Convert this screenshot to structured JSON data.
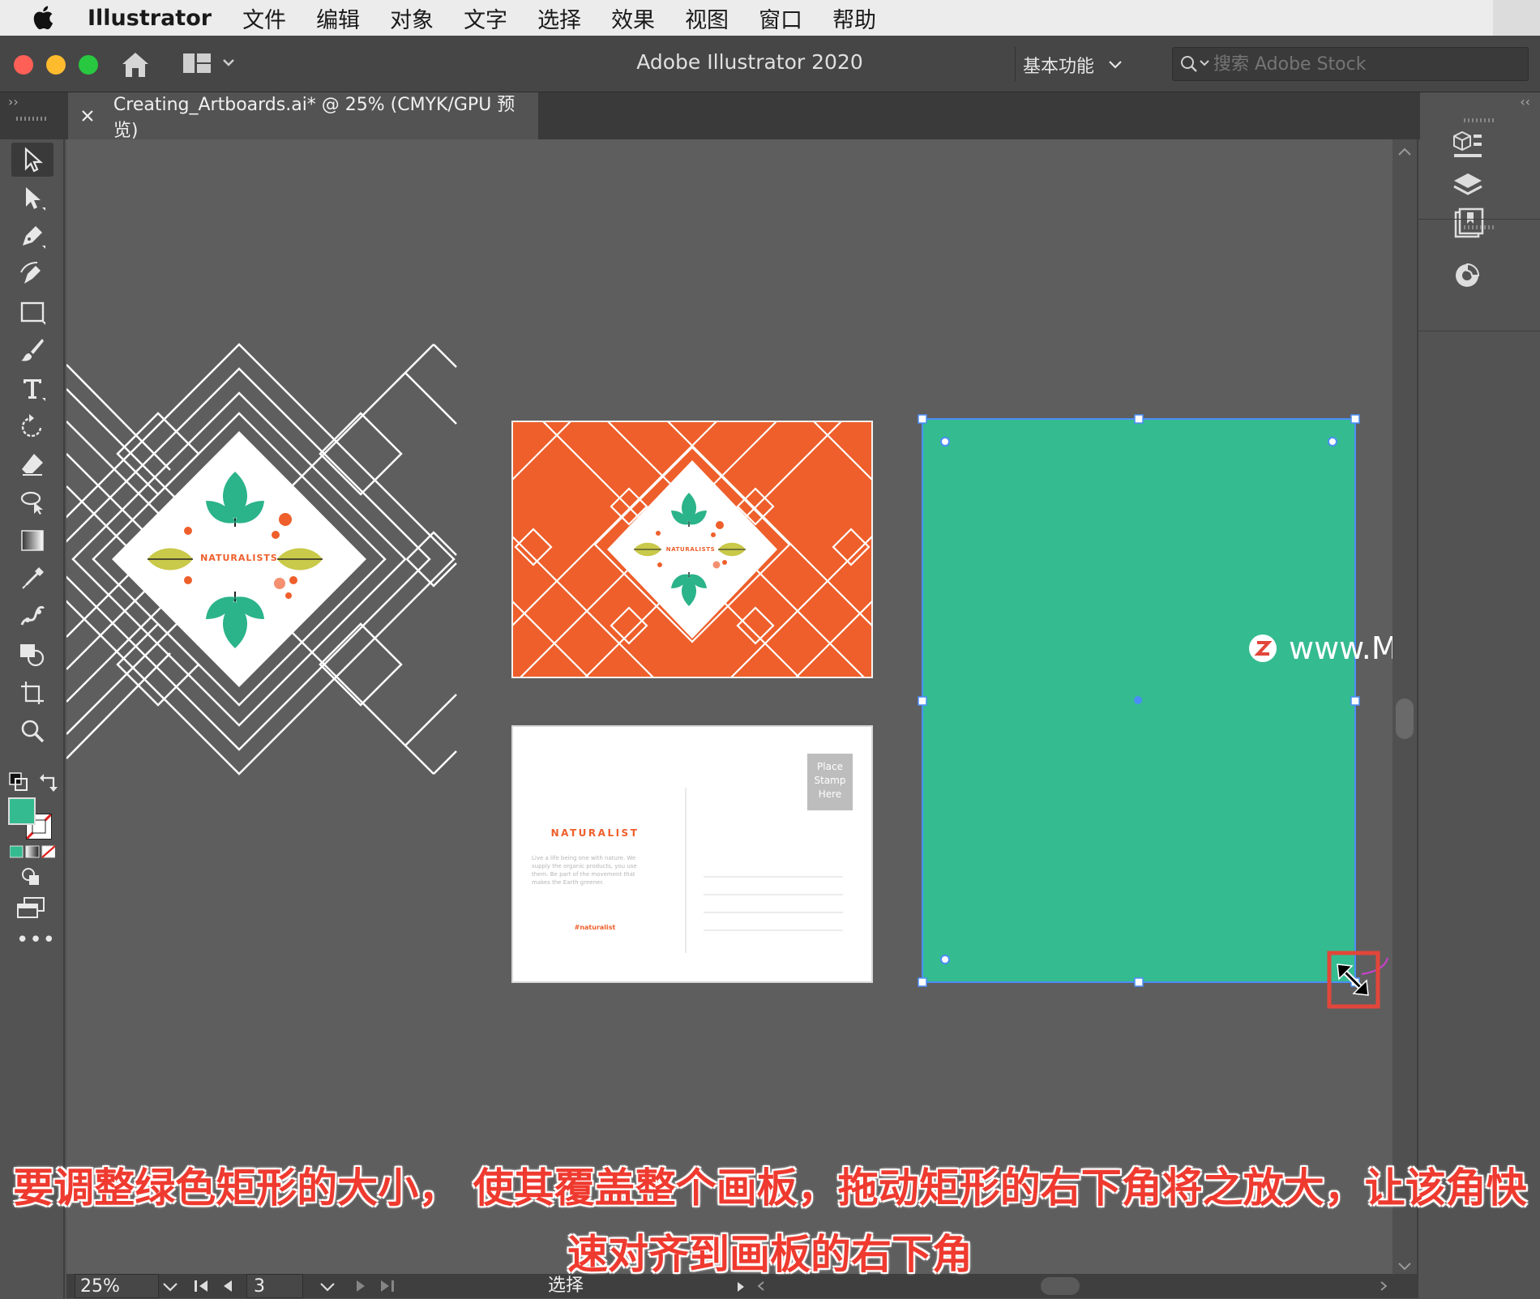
{
  "menubar": {
    "app_name": "Illustrator",
    "items": [
      "文件",
      "编辑",
      "对象",
      "文字",
      "选择",
      "效果",
      "视图",
      "窗口",
      "帮助"
    ]
  },
  "titlebar": {
    "title": "Adobe Illustrator 2020",
    "workspace": "基本功能",
    "stock_search_placeholder": "搜索 Adobe Stock"
  },
  "document_tab": {
    "label": "Creating_Artboards.ai* @ 25% (CMYK/GPU 预览)"
  },
  "artwork": {
    "brand": "NATURALISTS",
    "postcard_brand": "NATURALIST",
    "stamp_text": [
      "Place",
      "Stamp",
      "Here"
    ],
    "postcard_body": [
      "Live a life being one with nature. We",
      "supply the organic products, you use",
      "them. Be part of the movement that",
      "makes the Earth greener."
    ],
    "hashtag": "#naturalist"
  },
  "statusbar": {
    "zoom": "25%",
    "artboard_number": "3",
    "tool_status": "选择"
  },
  "watermark": "www.MacZ.com",
  "captions": {
    "line1": "要调整绿色矩形的大小， 使其覆盖整个画板，拖动矩形的右下角将之放大，让该角快",
    "line2": "速对齐到画板的右下角"
  },
  "colors": {
    "green_fill": "#35bb90",
    "orange_card": "#ee5f2b",
    "selection_blue": "#4b8df8",
    "highlight_red": "#e2463a"
  }
}
